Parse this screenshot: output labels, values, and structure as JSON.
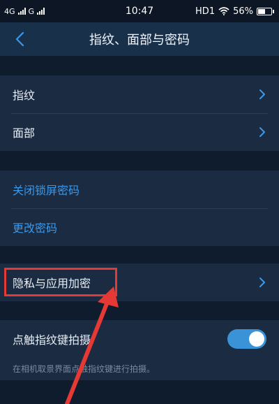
{
  "status_bar": {
    "network": "4G",
    "network2": "G",
    "time": "10:47",
    "hd": "HD1",
    "battery_text": "56%",
    "battery_level": 0.56
  },
  "header": {
    "title": "指纹、面部与密码"
  },
  "group1": {
    "fingerprint": "指纹",
    "face": "面部"
  },
  "group2": {
    "disable_lock_password": "关闭锁屏密码",
    "change_password": "更改密码"
  },
  "group3": {
    "privacy_app_encryption": "隐私与应用加密"
  },
  "group4": {
    "touch_shoot": "点触指纹键拍摄",
    "touch_shoot_enabled": true,
    "touch_shoot_hint": "在相机取景界面点触指纹键进行拍摄。"
  },
  "colors": {
    "accent": "#3c98e8",
    "annotation": "#e53935"
  },
  "icons": {
    "back": "chevron-left-icon",
    "row_arrow": "chevron-right-icon"
  }
}
